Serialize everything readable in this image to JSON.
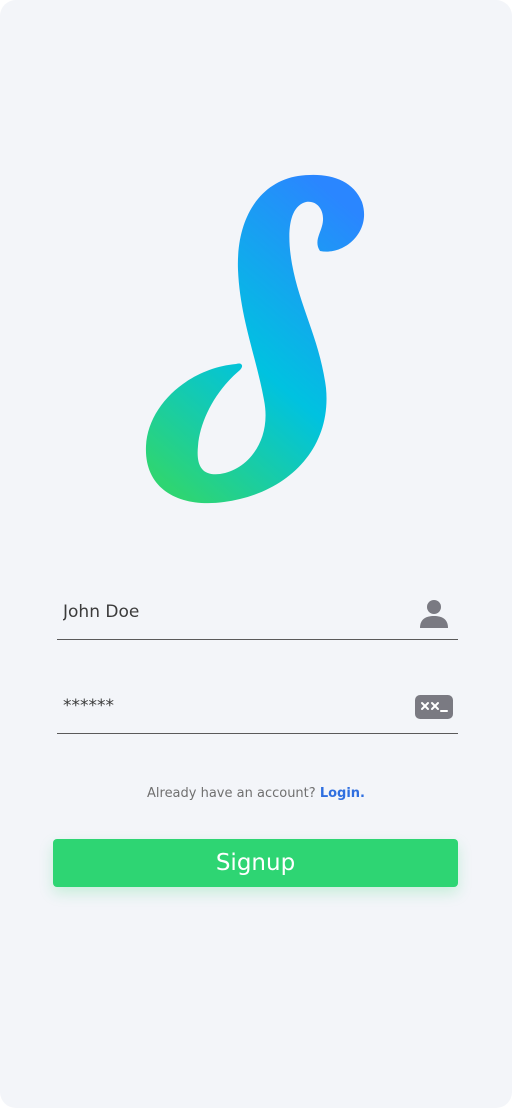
{
  "colors": {
    "background": "#f3f5f9",
    "accent_green": "#2ed573",
    "link_blue": "#2f6fe0",
    "logo_gradient_top": "#2a86ff",
    "logo_gradient_bottom": "#2ed573",
    "icon_gray": "#7a7a82"
  },
  "logo": {
    "icon": "s-letter-logo-icon"
  },
  "form": {
    "name_field": {
      "value": "John Doe",
      "icon": "person-icon"
    },
    "password_field": {
      "value": "******",
      "icon": "password-keyboard-icon"
    }
  },
  "prompt": {
    "text": "Already have an account?",
    "link": "Login."
  },
  "signup_button": {
    "label": "Signup"
  }
}
